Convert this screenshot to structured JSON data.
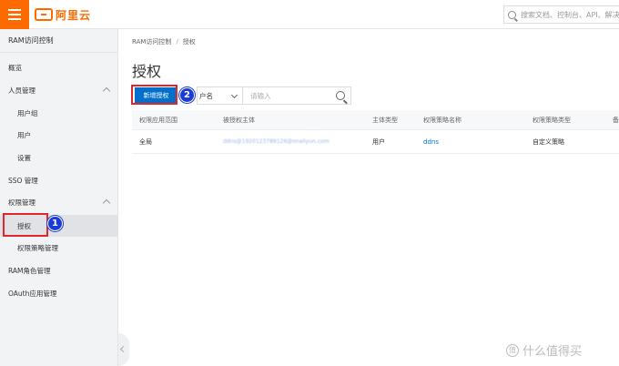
{
  "topbar": {
    "logo_text": "阿里云",
    "search_placeholder": "搜索文档、控制台、API、解决方"
  },
  "sidebar": {
    "title": "RAM访问控制",
    "items": [
      {
        "label": "概览",
        "level": 1
      },
      {
        "label": "人员管理",
        "level": 1,
        "expanded": true
      },
      {
        "label": "用户组",
        "level": 2
      },
      {
        "label": "用户",
        "level": 2
      },
      {
        "label": "设置",
        "level": 2
      },
      {
        "label": "SSO 管理",
        "level": 1
      },
      {
        "label": "权限管理",
        "level": 1,
        "expanded": true
      },
      {
        "label": "授权",
        "level": 2,
        "active": true
      },
      {
        "label": "权限策略管理",
        "level": 2
      },
      {
        "label": "RAM角色管理",
        "level": 1
      },
      {
        "label": "OAuth应用管理",
        "level": 1
      }
    ]
  },
  "main": {
    "breadcrumb": [
      "RAM访问控制",
      "授权"
    ],
    "breadcrumb_sep": "/",
    "title": "授权",
    "new_button_label": "新增授权",
    "filter_select": "户名",
    "filter_placeholder": "请输入",
    "table": {
      "headers": [
        "权限应用范围",
        "被授权主体",
        "主体类型",
        "权限策略名称",
        "权限策略类型",
        "备"
      ],
      "rows": [
        [
          "全局",
          "ddns@1920123789126@onaliyun.com",
          "用户",
          "ddns",
          "自定义策略"
        ]
      ]
    }
  },
  "annotations": [
    "1",
    "2"
  ],
  "watermark": "什么值得买",
  "colors": {
    "accent": "#ff6a00",
    "primary": "#0070cc",
    "highlight": "#e0282c",
    "badge": "#1a3bd6"
  }
}
